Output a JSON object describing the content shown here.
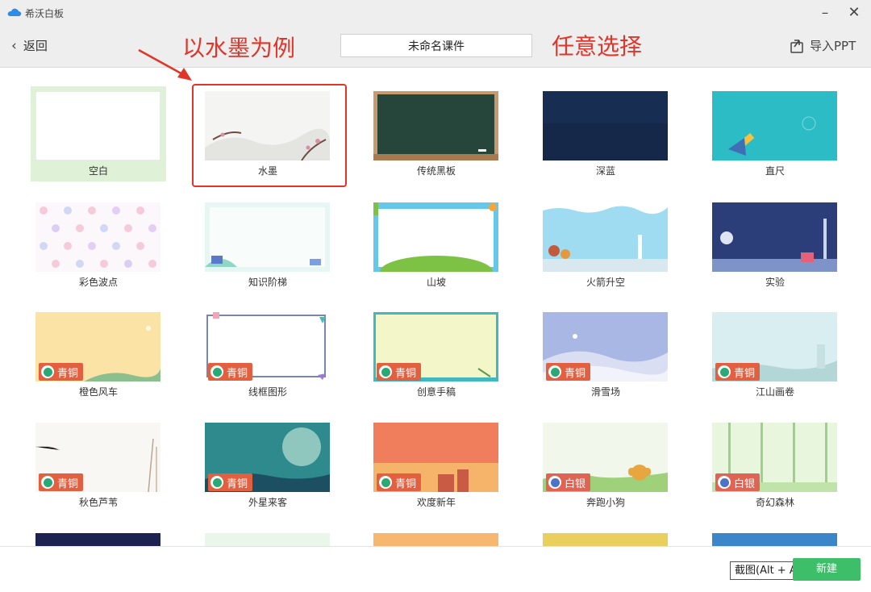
{
  "app": {
    "name": "希沃白板"
  },
  "window": {
    "minimize_glyph": "–",
    "close_glyph": "✕"
  },
  "header": {
    "back_label": "返回",
    "title_value": "未命名课件",
    "import_label": "导入PPT"
  },
  "annotations": {
    "left_text": "以水墨为例",
    "right_text": "任意选择",
    "color": "#e23428"
  },
  "badges": {
    "bronze": "青铜",
    "silver": "白银"
  },
  "templates": [
    {
      "label": "空白",
      "badge": null,
      "selected": true
    },
    {
      "label": "水墨",
      "badge": null
    },
    {
      "label": "传统黑板",
      "badge": null
    },
    {
      "label": "深蓝",
      "badge": null
    },
    {
      "label": "直尺",
      "badge": null
    },
    {
      "label": "彩色波点",
      "badge": null
    },
    {
      "label": "知识阶梯",
      "badge": null
    },
    {
      "label": "山坡",
      "badge": null
    },
    {
      "label": "火箭升空",
      "badge": null
    },
    {
      "label": "实验",
      "badge": null
    },
    {
      "label": "橙色风车",
      "badge": "青铜"
    },
    {
      "label": "线框图形",
      "badge": "青铜"
    },
    {
      "label": "创意手稿",
      "badge": "青铜"
    },
    {
      "label": "滑雪场",
      "badge": "青铜"
    },
    {
      "label": "江山画卷",
      "badge": "青铜"
    },
    {
      "label": "秋色芦苇",
      "badge": "青铜"
    },
    {
      "label": "外星来客",
      "badge": "青铜"
    },
    {
      "label": "欢度新年",
      "badge": "青铜"
    },
    {
      "label": "奔跑小狗",
      "badge": "白银"
    },
    {
      "label": "奇幻森林",
      "badge": "白银"
    }
  ],
  "footer": {
    "tooltip": "截图(Alt + A)",
    "new_label": "新建"
  },
  "colors": {
    "accent_green": "#3cbf68",
    "selected_bg": "#dff2d8",
    "badge_bronze": "#e2603f"
  }
}
